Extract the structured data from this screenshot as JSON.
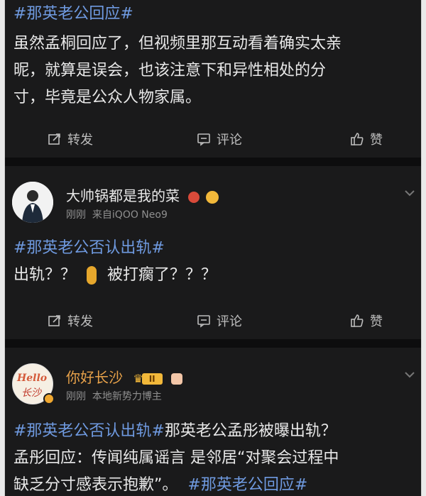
{
  "post1": {
    "hashtag": "#那英老公回应#",
    "line1": "虽然孟桐回应了，但视频里那互动看着确实太亲",
    "line2": "昵，就算是误会，也该注意下和异性相处的分",
    "line3": "寸，毕竟是公众人物家属。"
  },
  "post2": {
    "user": "大帅锅都是我的菜",
    "time": "刚刚",
    "source": "来自iQOO Neo9",
    "hashtag": "#那英老公否认出轨#",
    "text_a": "出轨？？",
    "text_b": "被打瘸了？？？"
  },
  "post3": {
    "user": "你好长沙",
    "avatar_label": "Hello",
    "avatar_sub": "长沙",
    "badge": "II",
    "time": "刚刚",
    "source": "本地新势力博主",
    "line1_hashtag": "#那英老公否认出轨#",
    "line1_rest": "那英老公孟彤被曝出轨？",
    "line2": "孟彤回应：传闻纯属谣言 是邻居“对聚会过程中",
    "line3_text": "缺乏分寸感表示抱歉”。",
    "line3_hashtag": "#那英老公回应#"
  },
  "actions": {
    "repost": "转发",
    "comment": "评论",
    "like": "赞"
  },
  "colors": {
    "hashtag": "#6f9ae0",
    "username_highlight": "#e8a24a",
    "background": "#1a1a1b"
  }
}
